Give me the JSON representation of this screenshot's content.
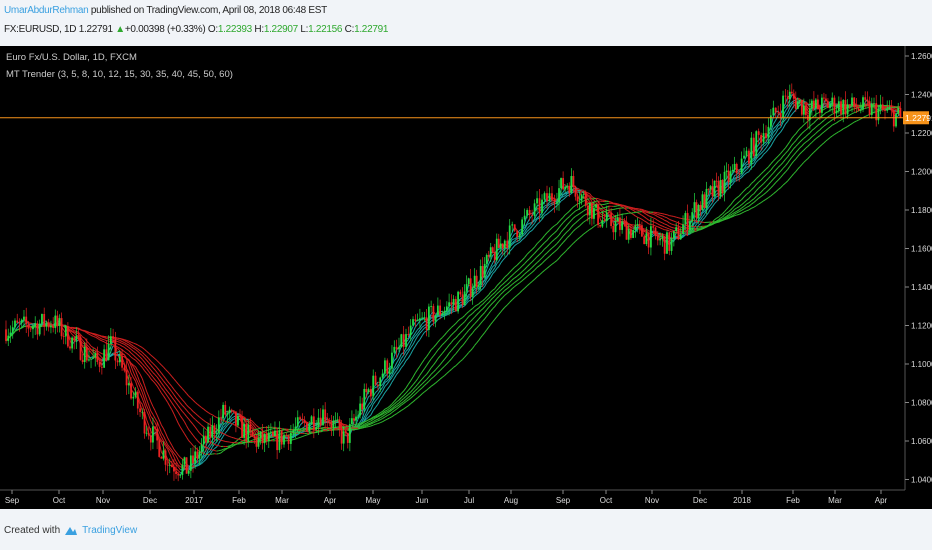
{
  "header": {
    "user": "UmarAbdurRehman",
    "published": "published on TradingView.com, April 08, 2018 06:48 EST"
  },
  "symbol": {
    "name": "FX:EURUSD, 1D",
    "last": "1.22791",
    "change": "+0.00398 (+0.33%)",
    "o_label": "O:",
    "o": "1.22393",
    "h_label": "H:",
    "h": "1.22907",
    "l_label": "L:",
    "l": "1.22156",
    "c_label": "C:",
    "c": "1.22791"
  },
  "legend": {
    "title": "Euro Fx/U.S. Dollar, 1D, FXCM",
    "indicator": "MT Trender (3, 5, 8, 10, 12, 15, 30, 35, 40, 45, 50, 60)"
  },
  "footer": {
    "created": "Created with",
    "brand": "TradingView"
  },
  "colors": {
    "bg": "#000000",
    "up": "#22dd44",
    "down": "#ee2222",
    "last_price": "#f7931a",
    "ma_up": "#2fb82f",
    "ma_up_fast": "#1aa3a3",
    "ma_down": "#cc1f1f"
  },
  "chart_data": {
    "type": "candlestick",
    "title": "Euro Fx/U.S. Dollar, 1D, FXCM",
    "ylim": [
      1.025,
      1.265
    ],
    "y_ticks": [
      "1.26000",
      "1.24000",
      "1.22000",
      "1.20000",
      "1.18000",
      "1.16000",
      "1.14000",
      "1.12000",
      "1.10000",
      "1.08000",
      "1.06000",
      "1.04000"
    ],
    "last_price": 1.22791,
    "last_price_label": "1.22791",
    "x_ticks": [
      "Sep",
      "Oct",
      "Nov",
      "Dec",
      "2017",
      "Feb",
      "Mar",
      "Apr",
      "May",
      "Jun",
      "Jul",
      "Aug",
      "Sep",
      "Oct",
      "Nov",
      "Dec",
      "2018",
      "Feb",
      "Mar",
      "Apr"
    ],
    "ma_periods": [
      3,
      5,
      8,
      10,
      12,
      15,
      30,
      35,
      40,
      45,
      50,
      60
    ],
    "path_month_index": [
      0,
      1,
      1.3,
      2,
      2.3,
      3,
      3.6,
      4,
      4.8,
      5.5,
      6,
      7,
      7.5,
      8,
      9,
      10,
      11,
      12,
      12.3,
      13,
      14,
      14.5,
      15,
      16,
      16.9,
      17,
      17.5,
      18,
      19,
      19.6
    ],
    "path_close": [
      1.118,
      1.122,
      1.115,
      1.1,
      1.11,
      1.07,
      1.048,
      1.045,
      1.075,
      1.06,
      1.06,
      1.075,
      1.06,
      1.085,
      1.12,
      1.135,
      1.165,
      1.19,
      1.195,
      1.175,
      1.167,
      1.162,
      1.18,
      1.2,
      1.235,
      1.24,
      1.232,
      1.235,
      1.232,
      1.2279
    ]
  }
}
